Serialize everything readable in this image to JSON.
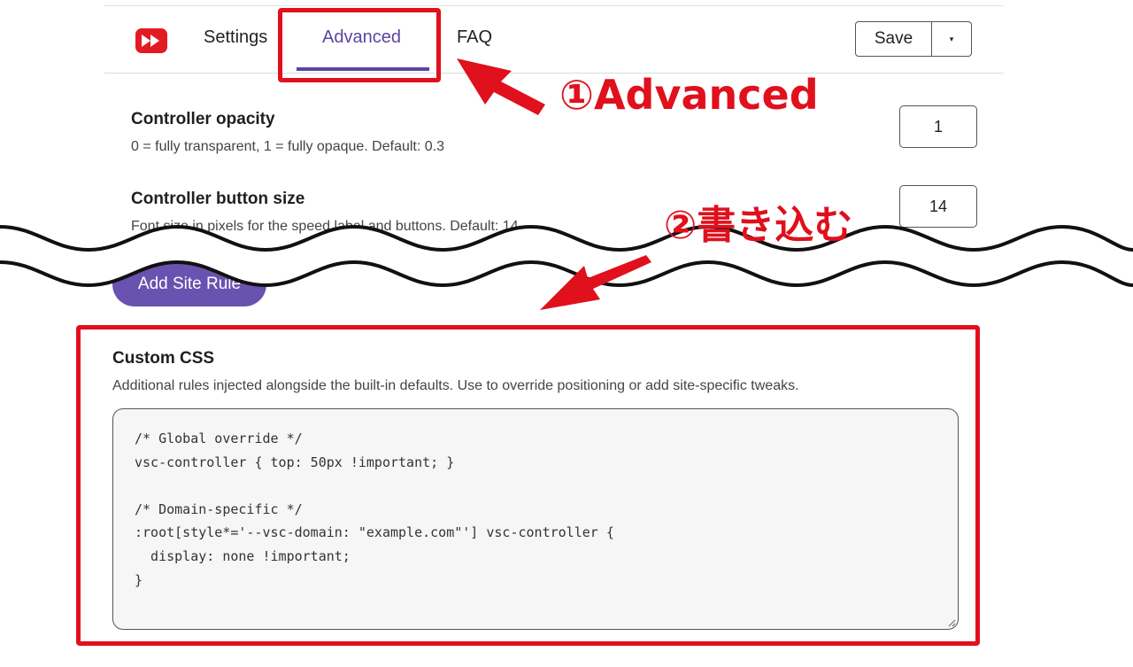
{
  "header": {
    "tabs": [
      {
        "label": "Settings"
      },
      {
        "label": "Advanced"
      },
      {
        "label": "FAQ"
      }
    ],
    "save_label": "Save",
    "accent_color": "#5b45a2"
  },
  "settings": {
    "opacity": {
      "title": "Controller opacity",
      "description": "0 = fully transparent, 1 = fully opaque. Default: 0.3",
      "value": "1"
    },
    "button_size": {
      "title": "Controller button size",
      "description": "Font size in pixels for the speed label and buttons. Default: 14",
      "value": "14"
    }
  },
  "site_rules": {
    "add_label": "Add Site Rule"
  },
  "custom_css": {
    "title": "Custom CSS",
    "description": "Additional rules injected alongside the built-in defaults. Use to override positioning or add site-specific tweaks.",
    "code_lines": [
      "/* Global override */",
      "vsc-controller { top: 50px !important; }",
      "",
      "/* Domain-specific */",
      ":root[style*='--vsc-domain: \"example.com\"'] vsc-controller {",
      "  display: none !important;",
      "}"
    ]
  },
  "annotations": {
    "step1": "①Advanced",
    "step2": "②書き込む",
    "color": "#e0101d"
  }
}
